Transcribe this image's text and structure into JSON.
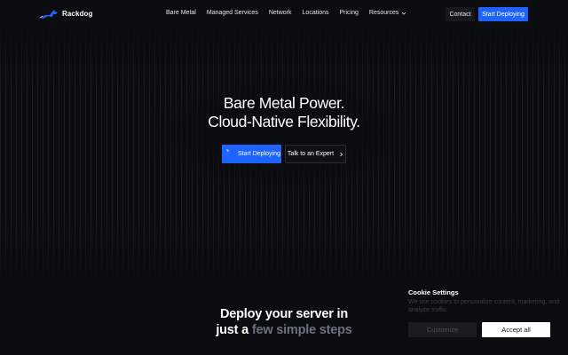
{
  "brand": {
    "name": "Rackdog",
    "icon": "dog-logo-icon",
    "accent": "#1f63ff"
  },
  "nav": {
    "links": [
      {
        "label": "Bare Metal"
      },
      {
        "label": "Managed Services"
      },
      {
        "label": "Network"
      },
      {
        "label": "Locations"
      },
      {
        "label": "Pricing"
      },
      {
        "label": "Resources"
      }
    ],
    "resources_icon": "chevron-down-icon",
    "contact_label": "Contact",
    "deploy_label": "Start Deploying"
  },
  "hero": {
    "title_line1": "Bare Metal Power.",
    "title_line2": "Cloud-Native Flexibility.",
    "primary_cta": "Start Deploying",
    "secondary_cta": "Talk to an Expert",
    "secondary_icon": "chevron-right-icon"
  },
  "steps": {
    "line1": "Deploy your server in",
    "line2_prefix": "just a",
    "line2_highlight": "few simple steps"
  },
  "cookie": {
    "title": "Cookie Settings",
    "text": "We use cookies to personalize content, marketing, and analyze traffic.",
    "customize_label": "Customize",
    "accept_label": "Accept all"
  }
}
